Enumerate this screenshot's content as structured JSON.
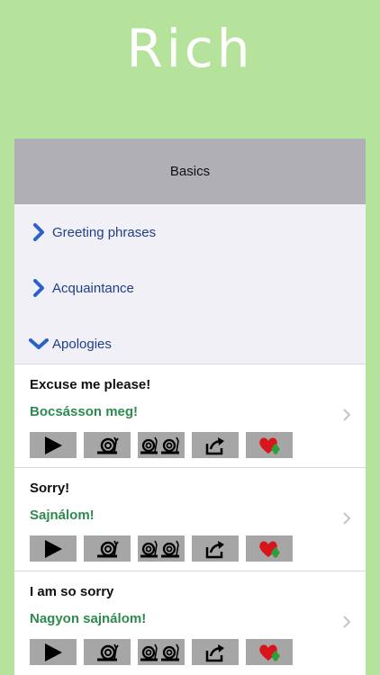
{
  "app": {
    "title": "Rich"
  },
  "header": {
    "title": "Basics"
  },
  "categories": [
    {
      "label": "Greeting phrases",
      "expanded": false
    },
    {
      "label": "Acquaintance",
      "expanded": false
    },
    {
      "label": "Apologies",
      "expanded": true
    }
  ],
  "phrases": [
    {
      "english": "Excuse me please!",
      "hungarian": "Bocsásson meg!"
    },
    {
      "english": "Sorry!",
      "hungarian": "Sajnálom!"
    },
    {
      "english": "I am so sorry",
      "hungarian": "Nagyon sajnálom!"
    }
  ],
  "buttons": {
    "icons": [
      "play-icon",
      "snail-icon",
      "two-snails-icon",
      "share-icon",
      "heart-clover-icon"
    ]
  },
  "colors": {
    "background": "#b5e39c",
    "header": "#b0afb5",
    "category_text": "#1f3f8a",
    "translation_text": "#2e8a4f",
    "button_bg": "#a6a6a6"
  }
}
